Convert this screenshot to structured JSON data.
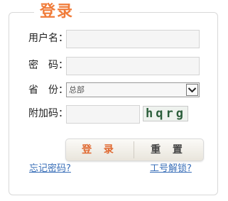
{
  "form": {
    "title": "登录",
    "username_label": "用户名：",
    "password_label": "密　码：",
    "province_label": "省　份：",
    "captcha_label": "附加码："
  },
  "inputs": {
    "username_value": "",
    "password_value": "",
    "captcha_value": ""
  },
  "province_select": {
    "selected": "总部"
  },
  "captcha_image": {
    "text": "hqrg"
  },
  "buttons": {
    "login": "登 录",
    "reset": "重 置"
  },
  "links": {
    "forgot_password": "忘记密码?",
    "unlock_account": "工号解锁?"
  },
  "colors": {
    "accent": "#f07c3a",
    "link": "#3a6fb8"
  }
}
